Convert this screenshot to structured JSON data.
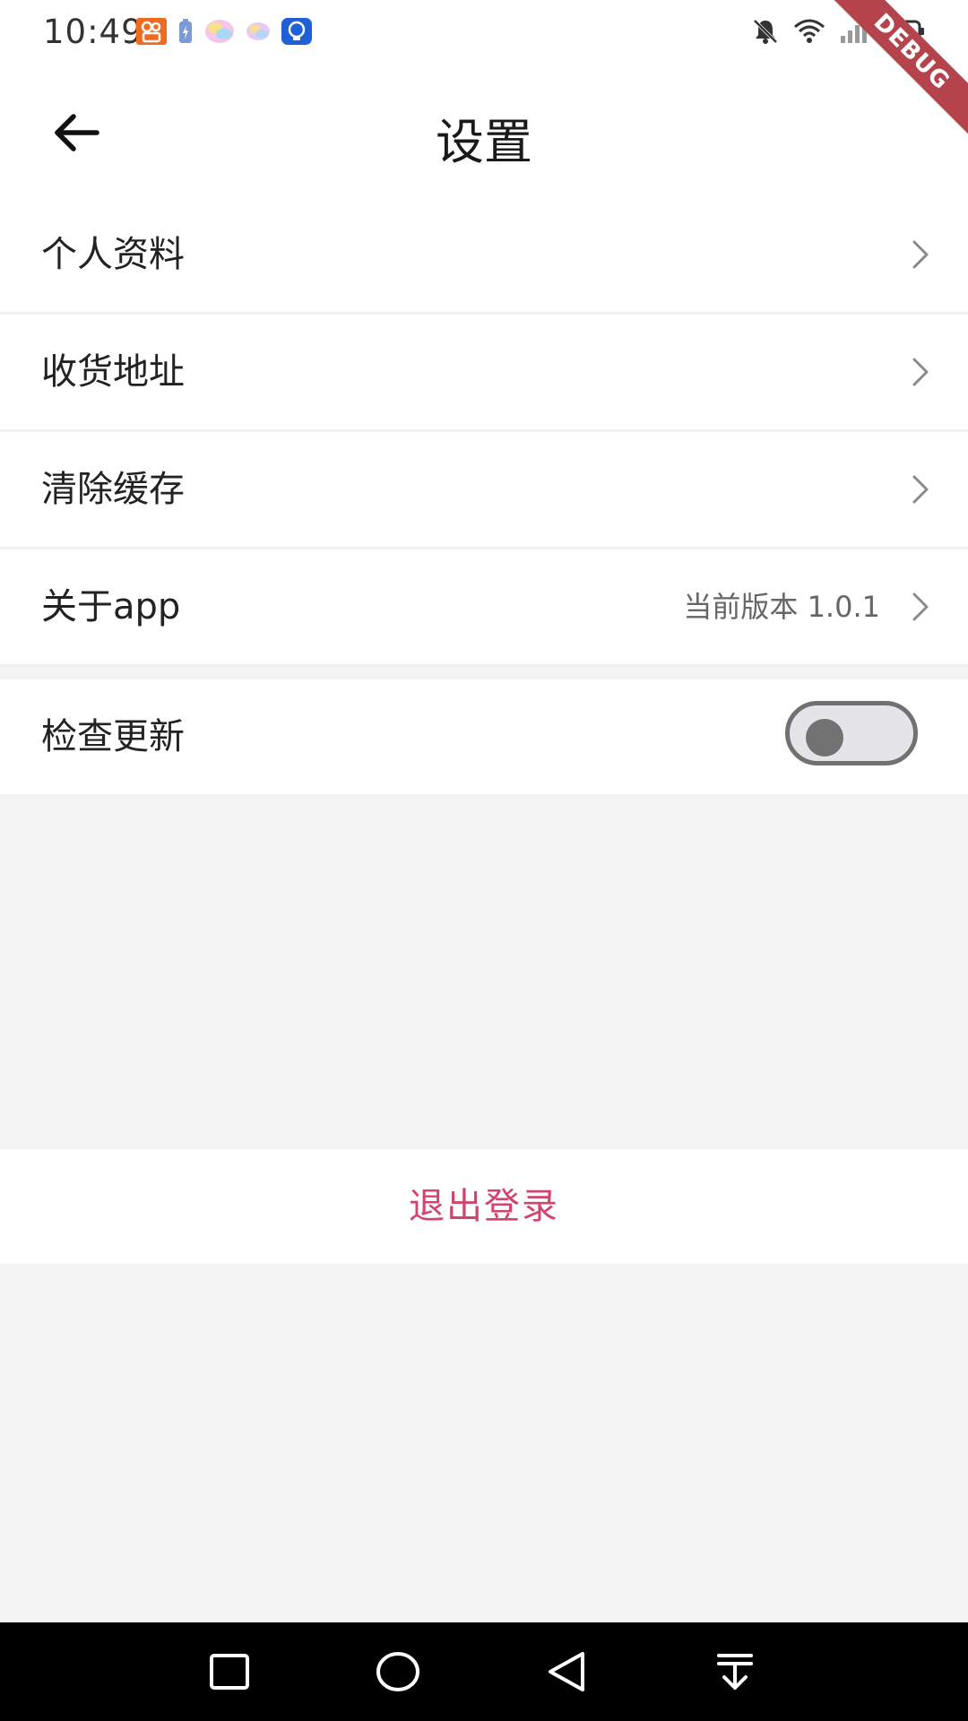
{
  "status_bar": {
    "time": "10:49",
    "notification_icons": [
      "ks-app-icon",
      "battery-saver-icon",
      "color-app-icon",
      "color-app-small-icon",
      "lightbulb-app-icon"
    ],
    "system_icons": [
      "bell-muted-icon",
      "wifi-icon",
      "signal-icon",
      "battery-icon"
    ],
    "debug_banner": "DEBUG"
  },
  "app_bar": {
    "title": "设置",
    "back_icon": "arrow-left-icon"
  },
  "settings": {
    "items": [
      {
        "label": "个人资料"
      },
      {
        "label": "收货地址"
      },
      {
        "label": "清除缓存"
      },
      {
        "label": "关于app",
        "value": "当前版本 1.0.1"
      }
    ],
    "check_update": {
      "label": "检查更新",
      "enabled": false
    }
  },
  "logout": {
    "label": "退出登录"
  },
  "colors": {
    "accent_logout": "#d1456c",
    "background": "#f4f4f5",
    "debug_ribbon": "#b5434c"
  },
  "nav_bar": {
    "buttons": [
      "recents-square-icon",
      "home-circle-icon",
      "back-triangle-icon",
      "notification-pull-down-icon"
    ]
  }
}
